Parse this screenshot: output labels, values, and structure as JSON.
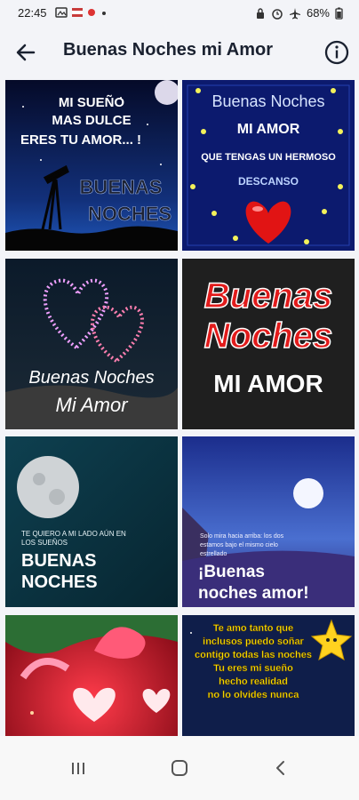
{
  "status_bar": {
    "time": "22:45",
    "battery": "68%"
  },
  "app_bar": {
    "title": "Buenas Noches mi Amor"
  },
  "images": [
    {
      "lines": [
        "MI SUEÑO",
        "MAS DULCE",
        "ERES TU AMOR... !",
        "BUENAS",
        "NOCHES"
      ]
    },
    {
      "lines": [
        "Buenas Noches",
        "MI AMOR",
        "QUE TENGAS UN HERMOSO",
        "DESCANSO"
      ]
    },
    {
      "lines": [
        "Buenas Noches",
        "Mi Amor"
      ]
    },
    {
      "lines": [
        "Buenas",
        "Noches",
        "MI AMOR"
      ]
    },
    {
      "lines": [
        "TE QUIERO A MI LADO AÚN EN",
        "LOS SUEÑOS",
        "BUENAS",
        "NOCHES"
      ]
    },
    {
      "lines": [
        "Solo mira hacia arriba: los dos",
        "estamos bajo el mismo cielo",
        "estrellado",
        "¡Buenas",
        "noches amor!"
      ]
    },
    {
      "lines": []
    },
    {
      "lines": [
        "Te amo tanto que",
        "inclusos puedo soñar",
        "contigo todas las noches",
        "Tu eres mi sueño",
        "hecho realidad",
        "no lo olvides nunca"
      ]
    }
  ]
}
